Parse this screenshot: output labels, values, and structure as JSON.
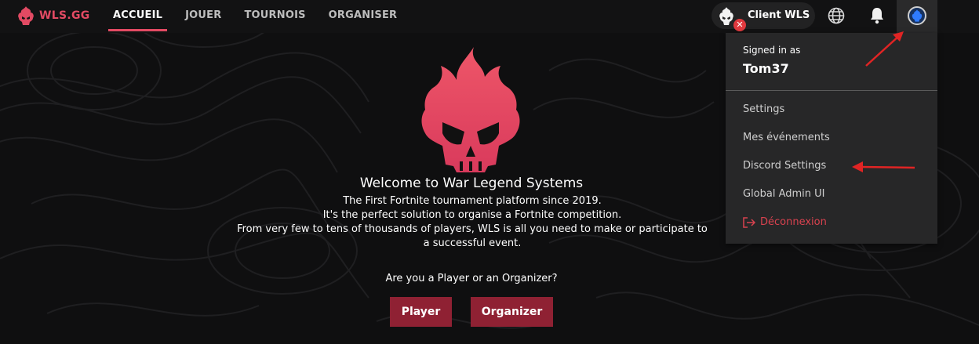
{
  "brand": {
    "name": "WLS.GG",
    "accent": "#e24a63"
  },
  "nav": {
    "items": [
      {
        "label": "ACCUEIL",
        "active": true
      },
      {
        "label": "JOUER",
        "active": false
      },
      {
        "label": "TOURNOIS",
        "active": false
      },
      {
        "label": "ORGANISER",
        "active": false
      }
    ]
  },
  "header": {
    "client_label": "Client WLS",
    "client_status_icon": "close-icon",
    "globe_icon": "globe-icon",
    "bell_icon": "bell-icon",
    "avatar_icon": "avatar-icon"
  },
  "dropdown": {
    "signed_in_label": "Signed in as",
    "username": "Tom37",
    "items": [
      {
        "label": "Settings"
      },
      {
        "label": "Mes événements"
      },
      {
        "label": "Discord Settings"
      },
      {
        "label": "Global Admin UI"
      }
    ],
    "logout_label": "Déconnexion",
    "logout_color": "#d9424f"
  },
  "hero": {
    "title": "Welcome to War Legend Systems",
    "lines": [
      "The First Fortnite tournament platform since 2019.",
      "It's the perfect solution to organise a Fortnite competition.",
      "From very few to tens of thousands of players, WLS is all you need to make or participate to",
      "a successful event."
    ],
    "question": "Are you a Player or an Organizer?",
    "player_button": "Player",
    "organizer_button": "Organizer",
    "button_color": "#8f2133"
  },
  "annotations": {
    "arrow_color": "#e02424"
  }
}
